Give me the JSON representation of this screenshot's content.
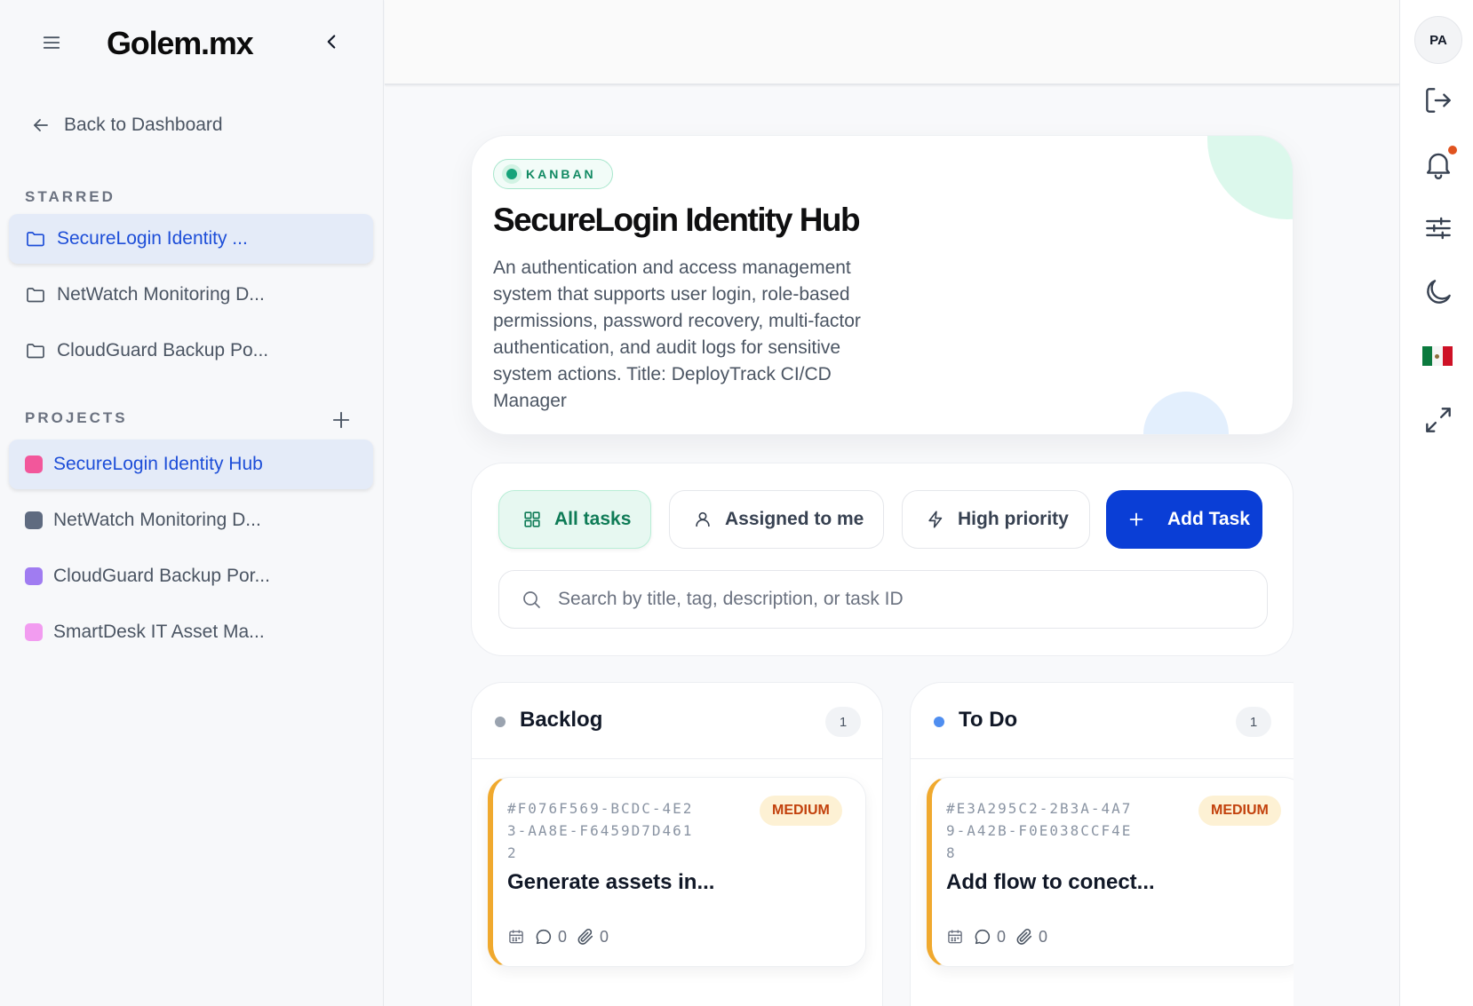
{
  "app": {
    "logo": "Golem.mx"
  },
  "sidebar": {
    "back_label": "Back to Dashboard",
    "starred_title": "STARRED",
    "projects_title": "PROJECTS",
    "starred": [
      {
        "label": "SecureLogin Identity ...",
        "active": true
      },
      {
        "label": "NetWatch Monitoring D...",
        "active": false
      },
      {
        "label": "CloudGuard Backup Po...",
        "active": false
      }
    ],
    "projects": [
      {
        "label": "SecureLogin Identity Hub",
        "color": "#f2579b",
        "active": true
      },
      {
        "label": "NetWatch Monitoring D...",
        "color": "#5f6b80",
        "active": false
      },
      {
        "label": "CloudGuard Backup Por...",
        "color": "#a07cf1",
        "active": false
      },
      {
        "label": "SmartDesk IT Asset Ma...",
        "color": "#f29cf0",
        "active": false
      }
    ]
  },
  "rail": {
    "avatar_initials": "PA",
    "icons": [
      "logout-icon",
      "bell-icon",
      "sliders-icon",
      "moon-icon",
      "mexico-flag-icon",
      "expand-icon"
    ],
    "notification_color": "#e0531f"
  },
  "hero": {
    "badge": "KANBAN",
    "title": "SecureLogin Identity Hub",
    "description": "An authentication and access management system that supports user login, role-based permissions, password recovery, multi-factor authentication, and audit logs for sensitive system actions. Title: DeployTrack CI/CD Manager"
  },
  "toolbar": {
    "all_tasks": "All tasks",
    "assigned": "Assigned to me",
    "high_priority": "High priority",
    "add_task": "Add Task",
    "search_placeholder": "Search by title, tag, description, or task ID",
    "accent": "#0a3ed6"
  },
  "columns": [
    {
      "title": "Backlog",
      "count": "1",
      "dot_color": "#9aa3af",
      "task": {
        "id": "#F076F569-BCDC-4E23-AA8E-F6459D7D4612",
        "priority": "MEDIUM",
        "title": "Generate assets in...",
        "comments": "0",
        "attachments": "0"
      }
    },
    {
      "title": "To Do",
      "count": "1",
      "dot_color": "#4f8ef0",
      "task": {
        "id": "#E3A295C2-2B3A-4A79-A42B-F0E038CCF4E8",
        "priority": "MEDIUM",
        "title": "Add flow to conect...",
        "comments": "0",
        "attachments": "0"
      }
    }
  ]
}
